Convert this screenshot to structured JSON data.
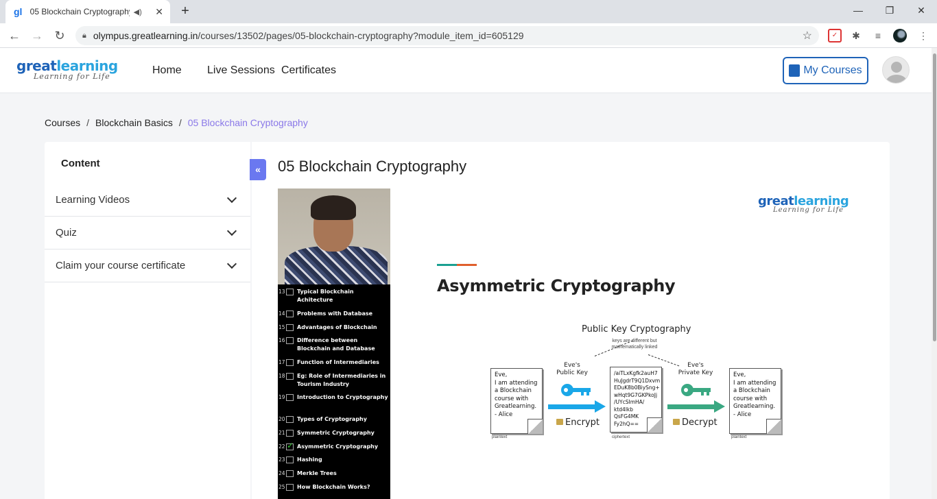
{
  "browser": {
    "tab_title": "05 Blockchain Cryptography",
    "tab_favicon": "gl",
    "new_tab_label": "+",
    "url_host": "olympus.greatlearning.in",
    "url_path": "/courses/13502/pages/05-blockchain-cryptography?module_item_id=605129"
  },
  "site": {
    "logo_part1": "great",
    "logo_part2": "learning",
    "logo_tagline": "Learning for Life",
    "nav": [
      "Home",
      "Live Sessions",
      "Certificates"
    ],
    "my_courses_label": "My Courses"
  },
  "breadcrumb": [
    "Courses",
    "Blockchain Basics",
    "05 Blockchain Cryptography"
  ],
  "sidebar": {
    "title": "Content",
    "collapse_label": "«",
    "items": [
      "Learning Videos",
      "Quiz",
      "Claim your course certificate"
    ]
  },
  "page": {
    "title": "05 Blockchain Cryptography"
  },
  "slide": {
    "logo_part1": "great",
    "logo_part2": "learning",
    "logo_tagline": "Learning for Life",
    "heading": "Asymmetric Cryptography",
    "toc": [
      {
        "num": "13",
        "text": "Typical Blockchain Achitecture",
        "checked": false
      },
      {
        "num": "14",
        "text": "Problems with Database",
        "checked": false
      },
      {
        "num": "15",
        "text": "Advantages of Blockchain",
        "checked": false
      },
      {
        "num": "16",
        "text": "Difference between Blockchain and Database",
        "checked": false
      },
      {
        "num": "17",
        "text": "Function of Intermediaries",
        "checked": false
      },
      {
        "num": "18",
        "text": "Eg: Role of Intermediaries in Tourism Industry",
        "checked": false
      },
      {
        "num": "19",
        "text": "Introduction to Cryptography",
        "checked": false
      },
      {
        "num": "20",
        "text": "Types of Cryptography",
        "checked": false
      },
      {
        "num": "21",
        "text": "Symmetric Cryptography",
        "checked": false
      },
      {
        "num": "22",
        "text": "Asymmetric Cryptography",
        "checked": true
      },
      {
        "num": "23",
        "text": "Hashing",
        "checked": false
      },
      {
        "num": "24",
        "text": "Merkle Trees",
        "checked": false
      },
      {
        "num": "25",
        "text": "How Blockchain Works?",
        "checked": false
      }
    ],
    "diagram": {
      "title": "Public Key Cryptography",
      "subtitle": "keys are different but mathematically linked",
      "public_key_label": "Eve's\nPublic Key",
      "private_key_label": "Eve's\nPrivate Key",
      "encrypt_label": "Encrypt",
      "decrypt_label": "Decrypt",
      "plaintext_doc": "Eve,\nI am attending\na Blockchain\ncourse with\nGreatlearning.\n- Alice",
      "ciphertext_doc": "/aiTLxKgfk2auH7\nHuJgdrT9Q1Dxvm\nEDuK8b0BiySng+\nwHqt9G7GKPkoJj\n/UYcSImHA/\nktd4lkb\nQsFG4MK\nFy2hQ==",
      "plaintext_label": "plaintext",
      "ciphertext_label": "ciphertext",
      "public_key_color": "#1aa7e8",
      "private_key_color": "#3aa882"
    }
  }
}
